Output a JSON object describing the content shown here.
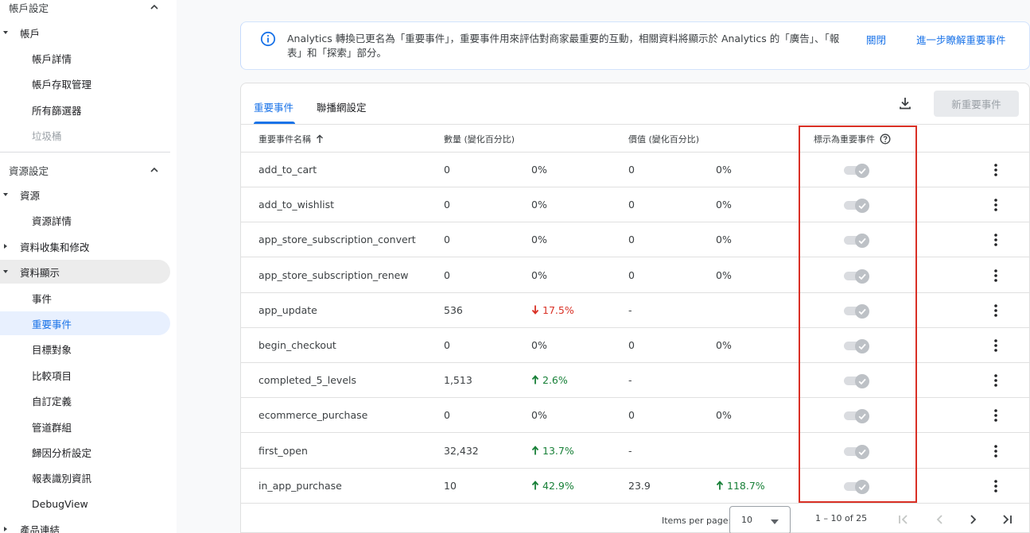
{
  "sidebar": {
    "account_section": "帳戶設定",
    "account_parent": "帳戶",
    "account_items": [
      "帳戶詳情",
      "帳戶存取管理",
      "所有篩選器",
      "垃圾桶"
    ],
    "property_section": "資源設定",
    "property_parent": "資源",
    "property_detail": "資源詳情",
    "data_collection": "資料收集和修改",
    "data_display": "資料顯示",
    "display_items": [
      "事件",
      "重要事件",
      "目標對象",
      "比較項目",
      "自訂定義",
      "管道群組",
      "歸因分析設定",
      "報表識別資訊",
      "DebugView"
    ],
    "product_links": "產品連結"
  },
  "banner": {
    "message": "Analytics 轉換已更名為「重要事件」，重要事件用來評估對商家最重要的互動，相關資料將顯示於 Analytics 的「廣告」、「報表」和「探索」部分。",
    "dismiss": "關閉",
    "learn_more": "進一步瞭解重要事件"
  },
  "tabs": [
    "重要事件",
    "聯播網設定"
  ],
  "new_button": "新重要事件",
  "table": {
    "headers": {
      "name": "重要事件名稱",
      "count": "數量 (變化百分比)",
      "value": "價值 (變化百分比)",
      "mark": "標示為重要事件"
    },
    "rows": [
      {
        "name": "add_to_cart",
        "count": "0",
        "count_change": "0%",
        "count_dir": "none",
        "value": "0",
        "value_change": "0%",
        "value_dir": "none"
      },
      {
        "name": "add_to_wishlist",
        "count": "0",
        "count_change": "0%",
        "count_dir": "none",
        "value": "0",
        "value_change": "0%",
        "value_dir": "none"
      },
      {
        "name": "app_store_subscription_convert",
        "count": "0",
        "count_change": "0%",
        "count_dir": "none",
        "value": "0",
        "value_change": "0%",
        "value_dir": "none"
      },
      {
        "name": "app_store_subscription_renew",
        "count": "0",
        "count_change": "0%",
        "count_dir": "none",
        "value": "0",
        "value_change": "0%",
        "value_dir": "none"
      },
      {
        "name": "app_update",
        "count": "536",
        "count_change": "17.5%",
        "count_dir": "down",
        "value": "-",
        "value_change": "",
        "value_dir": "none"
      },
      {
        "name": "begin_checkout",
        "count": "0",
        "count_change": "0%",
        "count_dir": "none",
        "value": "0",
        "value_change": "0%",
        "value_dir": "none"
      },
      {
        "name": "completed_5_levels",
        "count": "1,513",
        "count_change": "2.6%",
        "count_dir": "up",
        "value": "-",
        "value_change": "",
        "value_dir": "none"
      },
      {
        "name": "ecommerce_purchase",
        "count": "0",
        "count_change": "0%",
        "count_dir": "none",
        "value": "0",
        "value_change": "0%",
        "value_dir": "none"
      },
      {
        "name": "first_open",
        "count": "32,432",
        "count_change": "13.7%",
        "count_dir": "up",
        "value": "-",
        "value_change": "",
        "value_dir": "none"
      },
      {
        "name": "in_app_purchase",
        "count": "10",
        "count_change": "42.9%",
        "count_dir": "up",
        "value": "23.9",
        "value_change": "118.7%",
        "value_dir": "up"
      }
    ]
  },
  "pagination": {
    "label": "Items per page:",
    "per_page": "10",
    "range": "1 – 10 of 25"
  },
  "colors": {
    "accent": "#1a73e8",
    "up": "#188038",
    "down": "#d93025",
    "highlight": "#d93025"
  }
}
